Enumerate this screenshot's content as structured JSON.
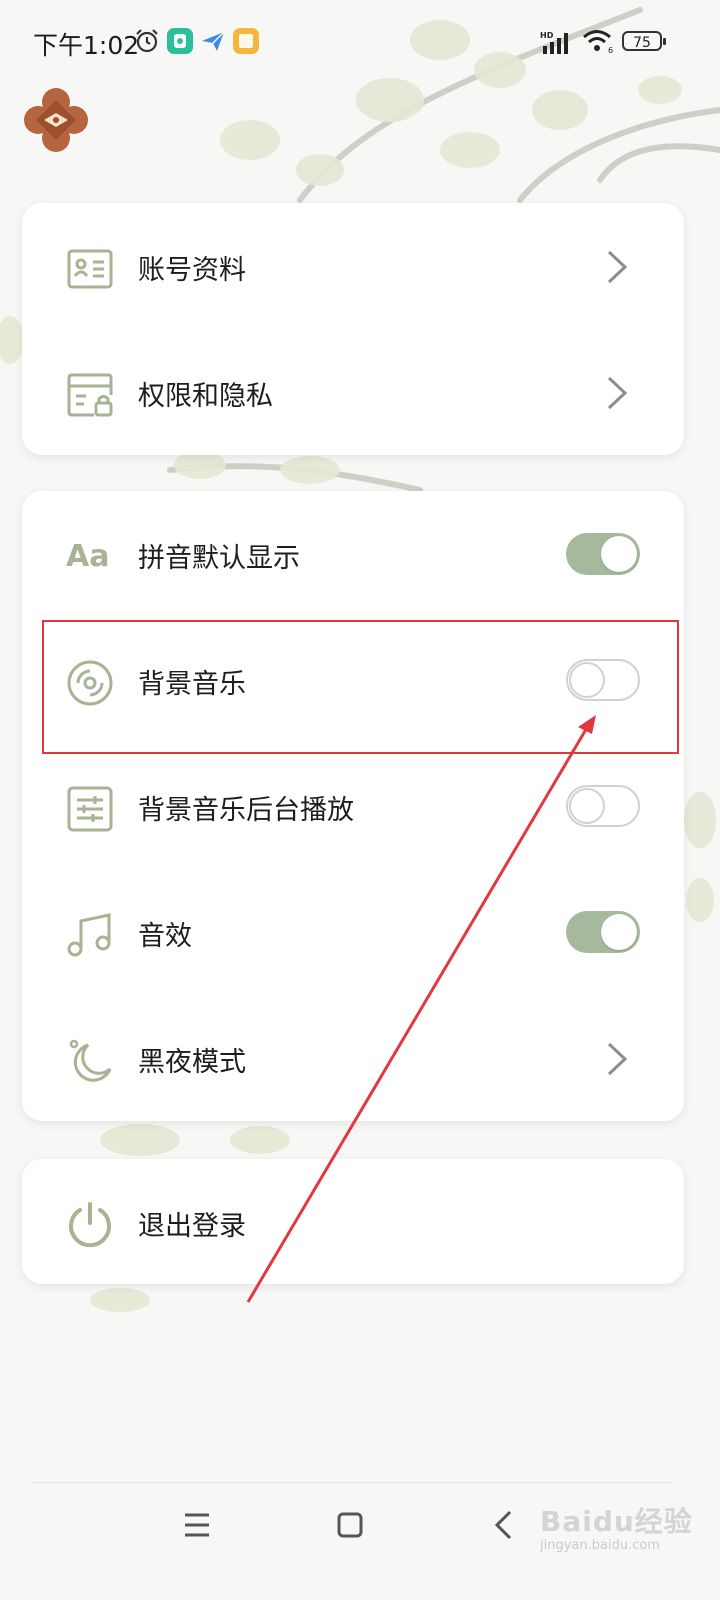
{
  "status_bar": {
    "time": "下午1:02",
    "battery": "75",
    "network_badge": "HD"
  },
  "menu_group_1": [
    {
      "label": "账号资料",
      "icon": "profile-card-icon",
      "control": "chevron"
    },
    {
      "label": "权限和隐私",
      "icon": "privacy-lock-icon",
      "control": "chevron"
    }
  ],
  "menu_group_2": [
    {
      "label": "拼音默认显示",
      "icon": "font-aa-icon",
      "icon_text": "Aa",
      "control": "toggle",
      "state": "on"
    },
    {
      "label": "背景音乐",
      "icon": "disc-icon",
      "control": "toggle",
      "state": "off"
    },
    {
      "label": "背景音乐后台播放",
      "icon": "sliders-icon",
      "control": "toggle",
      "state": "off"
    },
    {
      "label": "音效",
      "icon": "music-note-icon",
      "control": "toggle",
      "state": "on"
    },
    {
      "label": "黑夜模式",
      "icon": "moon-icon",
      "control": "chevron"
    }
  ],
  "logout": {
    "label": "退出登录",
    "icon": "power-icon"
  },
  "nav_bar": {
    "menu": "menu-icon",
    "home": "home-icon",
    "back": "back-icon"
  },
  "watermark": {
    "brand": "Baidu经验",
    "url": "jingyan.baidu.com"
  },
  "colors": {
    "accent_green": "#a7b99c",
    "icon_olive": "#a7b392",
    "annotation_red": "#e2373d"
  }
}
